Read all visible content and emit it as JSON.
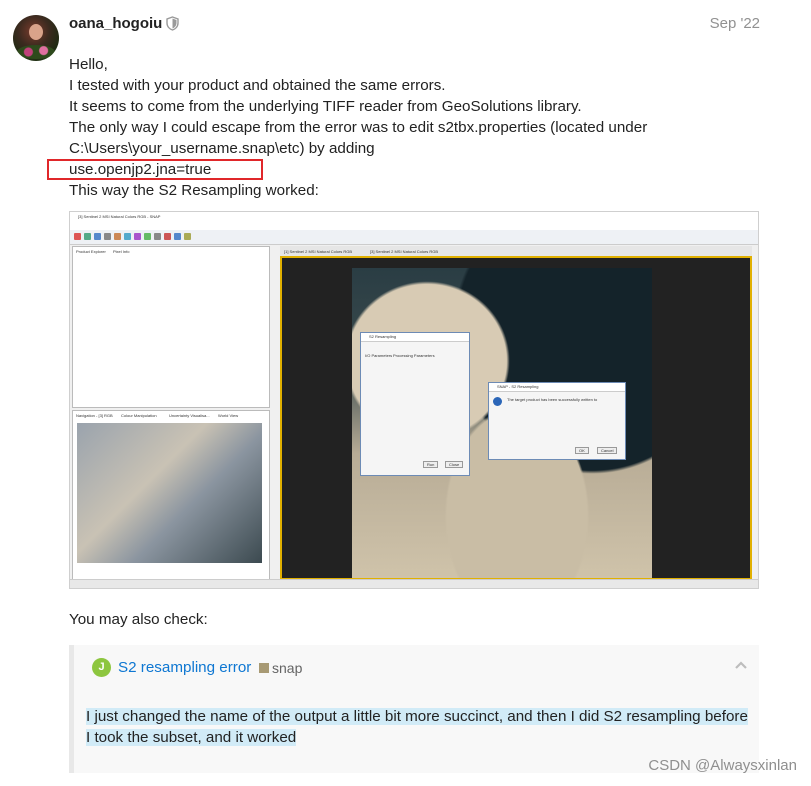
{
  "post": {
    "username": "oana_hogoiu",
    "date": "Sep '22",
    "lines": [
      "Hello,",
      "I tested with your product and obtained the same errors.",
      "It seems to come from the underlying TIFF reader from GeoSolutions library.",
      "The only way I could escape from the error was to edit s2tbx.properties (located under",
      "C:\\Users\\your_username.snap\\etc) by adding",
      "use.openjp2.jna=true",
      "This way the S2 Resampling worked:"
    ],
    "highlight_color": "#e0272a"
  },
  "screenshot": {
    "title": "[3] Sentinel 2 MSI Natural Colors RGB - SNAP",
    "tabs": [
      "[1] Sentinel 2 MSI Natural Colors RGB",
      "[3] Sentinel 2 MSI Natural Colors RGB"
    ],
    "left_tabs": [
      "Product Explorer",
      "Pixel Info"
    ],
    "nav_tabs": [
      "Navigation - [3] RGB",
      "Colour Manipulation",
      "Uncertainty Visualisa...",
      "World View"
    ],
    "dialog1": {
      "title": "S2 Resampling",
      "menu": [
        "File",
        "Help"
      ],
      "tabs": [
        "I/O Parameters",
        "Processing Parameters"
      ],
      "buttons": [
        "Run",
        "Close"
      ]
    },
    "dialog2": {
      "title": "SNAP - S2 Resampling",
      "message": "The target product has been successfully written to",
      "buttons": [
        "OK",
        "Cancel"
      ]
    }
  },
  "also_check": "You may also check:",
  "quote": {
    "icon_letter": "J",
    "icon_color": "#8dc63f",
    "link": "S2 resampling error",
    "tag": "snap",
    "text_line1": "I just changed the name of the output a little bit more succinct, and then I did S2 resampling before",
    "text_line2": "I took the subset, and it worked"
  },
  "watermark": "CSDN @Alwaysxinlan"
}
